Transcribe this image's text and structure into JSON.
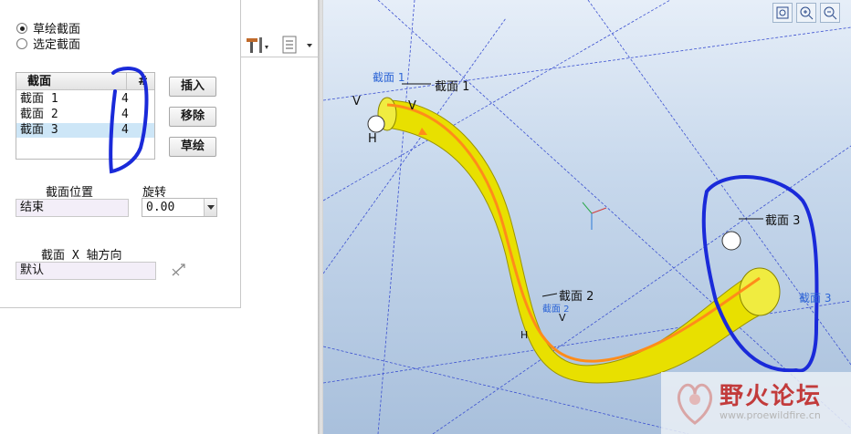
{
  "section_mode": {
    "options": [
      {
        "label": "草绘截面",
        "checked": true
      },
      {
        "label": "选定截面",
        "checked": false
      }
    ]
  },
  "sections_table": {
    "headers": [
      "截面",
      "#"
    ],
    "rows": [
      {
        "name": "截面 1",
        "count": "4",
        "selected": false
      },
      {
        "name": "截面 2",
        "count": "4",
        "selected": false
      },
      {
        "name": "截面 3",
        "count": "4",
        "selected": true
      }
    ]
  },
  "buttons": {
    "insert": "插入",
    "remove": "移除",
    "sketch": "草绘"
  },
  "section_location": {
    "label": "截面位置",
    "value": "结束"
  },
  "rotation": {
    "label": "旋转",
    "value": "0.00"
  },
  "x_axis": {
    "label": "截面 X 轴方向",
    "value": "默认"
  },
  "model_callouts": {
    "section1": "截面 1",
    "section2": "截面 2",
    "section3": "截面 3",
    "section3_blue": "截面 3",
    "section1_blue": "截面 1",
    "section2_blue": "截面 2"
  },
  "axis_markers": {
    "v1": "V",
    "v2": "V",
    "h1": "H",
    "h2": "H",
    "v3": "V"
  },
  "watermark": {
    "title": "野火论坛",
    "url": "www.proewildfire.cn"
  },
  "colors": {
    "tube": "#e8e000",
    "trajectory": "#ff8c1a",
    "annotation_pen": "#1a2ad9",
    "datum_lines": "#3a4fd0",
    "viewport_bg": "#b9cde6"
  },
  "icons": {
    "toolbar": [
      "tools-icon",
      "list-options-icon"
    ],
    "viewport": [
      "zoom-fit-icon",
      "zoom-in-icon",
      "zoom-out-icon"
    ],
    "x_axis_flip": "flip-direction-icon"
  }
}
